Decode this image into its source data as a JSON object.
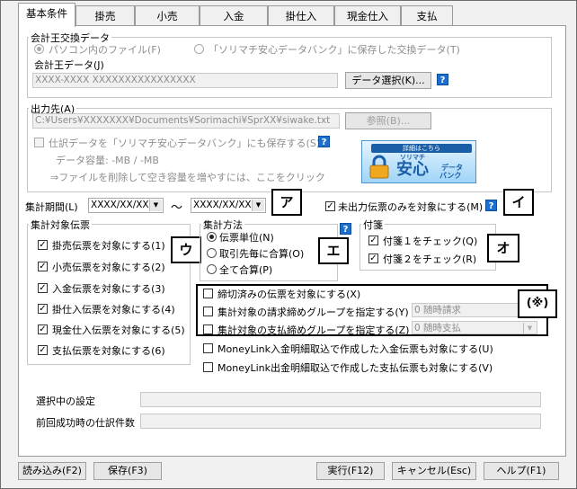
{
  "tabs": [
    "基本条件",
    "掛売",
    "小売",
    "入金",
    "掛仕入",
    "現金仕入",
    "支払"
  ],
  "exchange": {
    "title": "会計王交換データ",
    "opt_pc": "パソコン内のファイル(F)",
    "opt_bank": "「ソリマチ安心データバンク」に保存した交換データ(T)",
    "kaikeio_label": "会計王データ(J)",
    "kaikeio_value": "XXXX-XXXX XXXXXXXXXXXXXXXX",
    "select_button": "データ選択(K)...",
    "help": "?"
  },
  "output": {
    "title": "出力先(A)",
    "path": "C:¥Users¥XXXXXXX¥Documents¥Sorimachi¥SprXX¥siwake.txt",
    "browse_button": "参照(B)...",
    "save_bank_label": "仕訳データを「ソリマチ安心データバンク」にも保存する(S)",
    "capacity": "データ容量: -MB / -MB",
    "delete_hint": "⇒ファイルを削除して空き容量を増やすには、ここをクリック",
    "banner_top": "詳細はこちら",
    "banner_brand": "ソリマチ",
    "banner_main": "安心",
    "banner_sub": "データ",
    "banner_sub2": "バンク"
  },
  "period": {
    "label": "集計期間(L)",
    "from": "XXXX/XX/XX",
    "tilde": "～",
    "to": "XXXX/XX/XX",
    "unoutput_label": "未出力伝票のみを対象にする(M)"
  },
  "targets": {
    "title": "集計対象伝票",
    "items": [
      "掛売伝票を対象にする(1)",
      "小売伝票を対象にする(2)",
      "入金伝票を対象にする(3)",
      "掛仕入伝票を対象にする(4)",
      "現金仕入伝票を対象にする(5)",
      "支払伝票を対象にする(6)"
    ]
  },
  "method": {
    "title": "集計方法",
    "items": [
      "伝票単位(N)",
      "取引先毎に合算(O)",
      "全て合算(P)"
    ]
  },
  "fusen": {
    "title": "付箋",
    "items": [
      "付箋１をチェック(Q)",
      "付箋２をチェック(R)"
    ]
  },
  "options": {
    "closed_only": "締切済みの伝票を対象にする(X)",
    "billing_group": "集計対象の請求締めグループを指定する(Y)",
    "billing_value": "0 随時請求",
    "payment_group": "集計対象の支払締めグループを指定する(Z)",
    "payment_value": "0 随時支払",
    "ml_receipt": "MoneyLink入金明細取込で作成した入金伝票も対象にする(U)",
    "ml_payment": "MoneyLink出金明細取込で作成した支払伝票も対象にする(V)"
  },
  "info": {
    "current_setting": "選択中の設定",
    "last_count": "前回成功時の仕訳件数"
  },
  "footer": {
    "load": "読み込み(F2)",
    "save": "保存(F3)",
    "run": "実行(F12)",
    "cancel": "キャンセル(Esc)",
    "help": "ヘルプ(F1)"
  },
  "callouts": [
    "ア",
    "イ",
    "ウ",
    "エ",
    "オ",
    "(※)"
  ]
}
